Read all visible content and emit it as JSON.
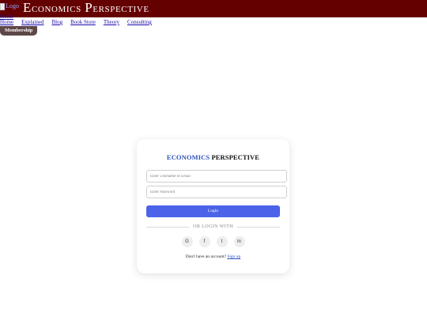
{
  "header": {
    "logo_alt": "Logo",
    "title_first_initial": "E",
    "title_first_rest": "conomics",
    "title_second_initial": "P",
    "title_second_rest": "erspective",
    "home_link": "Home"
  },
  "nav": {
    "items": [
      "Home",
      "Explained",
      "Blog",
      "Book Store",
      "Theory",
      "Consulting"
    ]
  },
  "membership_label": "Membership",
  "login_card": {
    "title_accent": "ECONOMICS",
    "title_dark": "PERSPECTIVE",
    "username_placeholder": "Enter Username or Email",
    "password_placeholder": "Enter Password",
    "login_button": "Login",
    "divider_text": "OR LOGIN WITH",
    "socials": [
      "G",
      "f",
      "t",
      "in"
    ],
    "signup_prompt": "Don't have an account?",
    "signup_link": "Sign up"
  },
  "colors": {
    "header_bg": "#650000",
    "accent_blue": "#2a52be",
    "login_button": "#4a63e8",
    "membership_bg": "#5e4747"
  }
}
